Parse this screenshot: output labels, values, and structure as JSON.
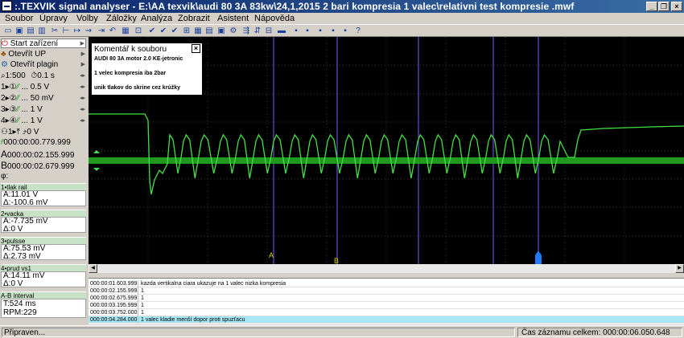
{
  "window": {
    "title": ":.TEXVIK  signal analyser - E:\\AA texvik\\audi 80 3A 83kw\\24,1,2015 2 bari kompresia 1 valec\\relativni test kompresie  .mwf"
  },
  "menu": [
    "Soubor",
    "Úpravy",
    "Volby",
    "Záložky",
    "Analýza",
    "Zobrazit",
    "Asistent",
    "Nápověda"
  ],
  "left": {
    "start_label": "Start zařízení",
    "open_up": "Otevřít UP",
    "open_plugin": "Otevřít plagin",
    "scale": "1:500",
    "timebase": "0.1 s",
    "channels": [
      {
        "num": "1",
        "range": "0.5 V"
      },
      {
        "num": "2",
        "range": "50 mV"
      },
      {
        "num": "3",
        "range": "1 V"
      },
      {
        "num": "4",
        "range": "1 V"
      }
    ],
    "trigger_level": "0 V",
    "trigger_time": "000:00:00.779.999",
    "cursor_a": "000:00:02.155.999",
    "cursor_b": "000:00:02.679.999",
    "phi": "φ:"
  },
  "channel_values": [
    {
      "name": "1•tlak rail",
      "a": "A:11.01 V",
      "d": "Δ:-100.6 mV"
    },
    {
      "name": "2•vacka",
      "a": "A:-7.735 mV",
      "d": "Δ:0 V"
    },
    {
      "name": "3•pulsse",
      "a": "A:75.53 mV",
      "d": "Δ:2.73 mV"
    },
    {
      "name": "4•prud vs1",
      "a": "A:14.11 mV",
      "d": "Δ:0 V"
    }
  ],
  "ab_interval": {
    "label": "A-B interval",
    "t": "T:524 ms",
    "rpm": "RPM:229"
  },
  "comment": {
    "title": "Komentář k souboru",
    "line1": "AUDI 80 3A motor 2.0 KE-jetronic",
    "line2": "1 velec kompresia iba 2bar",
    "line3": "unik tlakov do skrine cez krúžky"
  },
  "markers": {
    "a": "A",
    "b": "B"
  },
  "events": [
    {
      "time": "000:00:01.603.999",
      "text": "kazda  vertikalna ciara ukazuje na 1 valec nizka kompresia"
    },
    {
      "time": "000:00:02.155.999",
      "text": "1"
    },
    {
      "time": "000:00:02.675.999",
      "text": "1"
    },
    {
      "time": "000:00:03.195.999",
      "text": "1"
    },
    {
      "time": "000:00:03.752.000",
      "text": "1"
    },
    {
      "time": "000:00:04.284.000",
      "text": "1 valec kladie menší dopor proti spuzťacu"
    }
  ],
  "status": {
    "left": "Připraven...",
    "right": "Čas záznamu celkem: 000:00:06.050.648"
  },
  "colors": {
    "trace": "#44e044",
    "band": "#1f9a1f",
    "cursor": "#7a5cff",
    "grid": "#3a3a3a"
  }
}
